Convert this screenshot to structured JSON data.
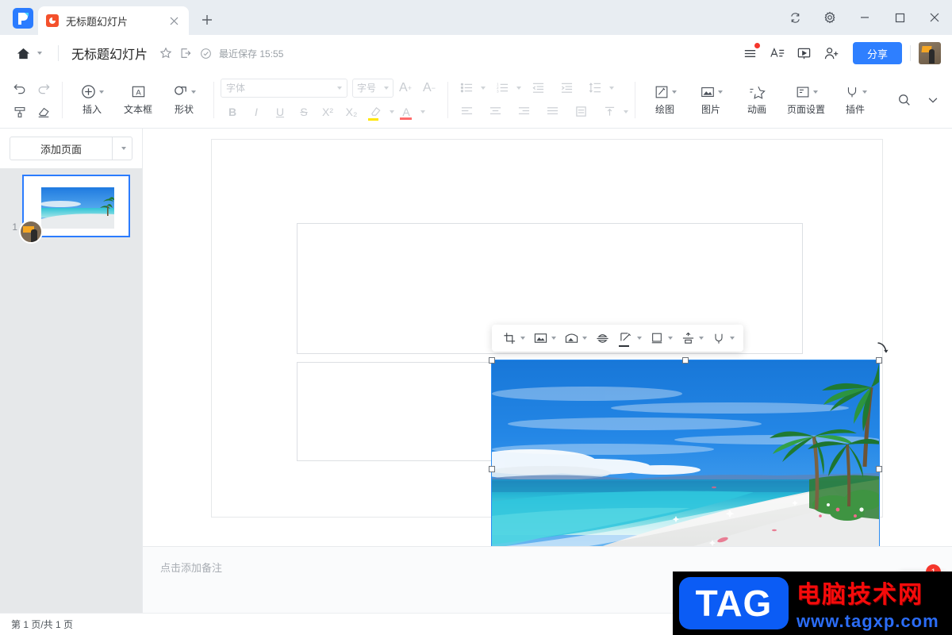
{
  "tabbar": {
    "logo_icon": "wps-logo",
    "tab": {
      "title": "无标题幻灯片",
      "app_icon": "presentation-icon",
      "close_icon": "close-icon"
    },
    "new_tab_label": "+",
    "window": {
      "sync_icon": "sync-icon",
      "settings_icon": "gear-icon",
      "minimize_icon": "minimize-icon",
      "maximize_icon": "maximize-icon",
      "close_icon": "close-icon"
    }
  },
  "titlebar": {
    "home_icon": "home-icon",
    "doc_title": "无标题幻灯片",
    "star_icon": "star-icon",
    "export_icon": "share-arrow-icon",
    "saved_check_icon": "check-circle-icon",
    "saved_text": "最近保存 15:55",
    "menu_icon": "hamburger-menu-icon",
    "typography_icon": "text-format-icon",
    "present_icon": "slideshow-icon",
    "invite_icon": "add-person-icon",
    "share_label": "分享",
    "share_color": "#2e7fff",
    "avatar_name": "user-avatar"
  },
  "ribbon": {
    "undo_icon": "undo-icon",
    "redo_icon": "redo-icon",
    "format_painter_icon": "format-painter-icon",
    "eraser_icon": "eraser-icon",
    "insert_label": "插入",
    "textbox_label": "文本框",
    "shape_label": "形状",
    "font_placeholder": "字体",
    "size_placeholder": "字号",
    "grow_font_label": "A",
    "shrink_font_label": "A",
    "bold_label": "B",
    "italic_label": "I",
    "underline_label": "U",
    "strike_label": "S",
    "superscript_label": "X²",
    "subscript_label": "X₂",
    "highlight_icon": "highlighter-icon",
    "font_color_icon": "font-color-icon",
    "bullets_icon": "bulleted-list-icon",
    "numbering_icon": "numbered-list-icon",
    "outdent_icon": "decrease-indent-icon",
    "indent_icon": "increase-indent-icon",
    "line_spacing_icon": "line-spacing-icon",
    "align_left_icon": "align-left-icon",
    "align_center_icon": "align-center-icon",
    "align_right_icon": "align-right-icon",
    "align_justify_icon": "align-justify-icon",
    "distribute_icon": "distribute-icon",
    "vertical_align_icon": "vertical-align-icon",
    "draw_label": "绘图",
    "picture_label": "图片",
    "animation_label": "动画",
    "page_setup_label": "页面设置",
    "plugin_label": "插件",
    "search_icon": "search-icon",
    "collapse_icon": "chevron-down-icon"
  },
  "sidebar": {
    "add_page_label": "添加页面",
    "add_page_dropdown_icon": "chevron-down-icon",
    "slides": [
      {
        "number": "1",
        "selected": true,
        "collaborator_avatar": "collaborator-avatar"
      }
    ]
  },
  "image_toolbar": {
    "items": [
      {
        "icon": "crop-icon",
        "has_caret": true
      },
      {
        "icon": "image-icon",
        "has_caret": true
      },
      {
        "icon": "image-effects-icon",
        "has_caret": true
      },
      {
        "icon": "flip-icon",
        "has_caret": false
      },
      {
        "icon": "edit-pen-icon",
        "has_caret": true
      },
      {
        "icon": "frame-icon",
        "has_caret": true
      },
      {
        "icon": "align-objects-icon",
        "has_caret": true
      },
      {
        "icon": "plugin-icon",
        "has_caret": true
      }
    ]
  },
  "canvas": {
    "selected_image_name": "beach-illustration",
    "rotate_handle_icon": "rotate-icon",
    "link_badge_icon": "link-icon",
    "placeholders": [
      "title-placeholder",
      "subtitle-placeholder"
    ]
  },
  "notes": {
    "placeholder": "点击添加备注"
  },
  "status": {
    "page_text": "第 1 页/共 1 页"
  },
  "corner": {
    "badge_count": "1"
  },
  "watermark": {
    "tag": "TAG",
    "site_cn": "电脑技术网",
    "url": "www.tagxp.com"
  }
}
